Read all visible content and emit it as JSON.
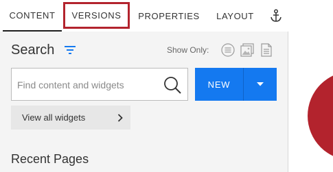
{
  "tabs": {
    "content": "CONTENT",
    "versions": "VERSIONS",
    "properties": "PROPERTIES",
    "layout": "LAYOUT",
    "anchor_icon": "anchor-icon"
  },
  "search": {
    "title": "Search",
    "filter_icon": "filter-icon",
    "show_only_label": "Show Only:",
    "show_only_icons": [
      "list-icon",
      "image-icon",
      "document-icon"
    ],
    "placeholder": "Find content and widgets",
    "search_icon": "magnifier-icon"
  },
  "new_button": {
    "label": "NEW",
    "dropdown_icon": "caret-down-icon"
  },
  "widgets": {
    "label": "View all widgets",
    "chevron_icon": "chevron-right-icon"
  },
  "recent": {
    "title": "Recent Pages"
  },
  "colors": {
    "accent_blue": "#1479f0",
    "highlight_red": "#b3232d",
    "panel_bg": "#f4f4f4"
  }
}
